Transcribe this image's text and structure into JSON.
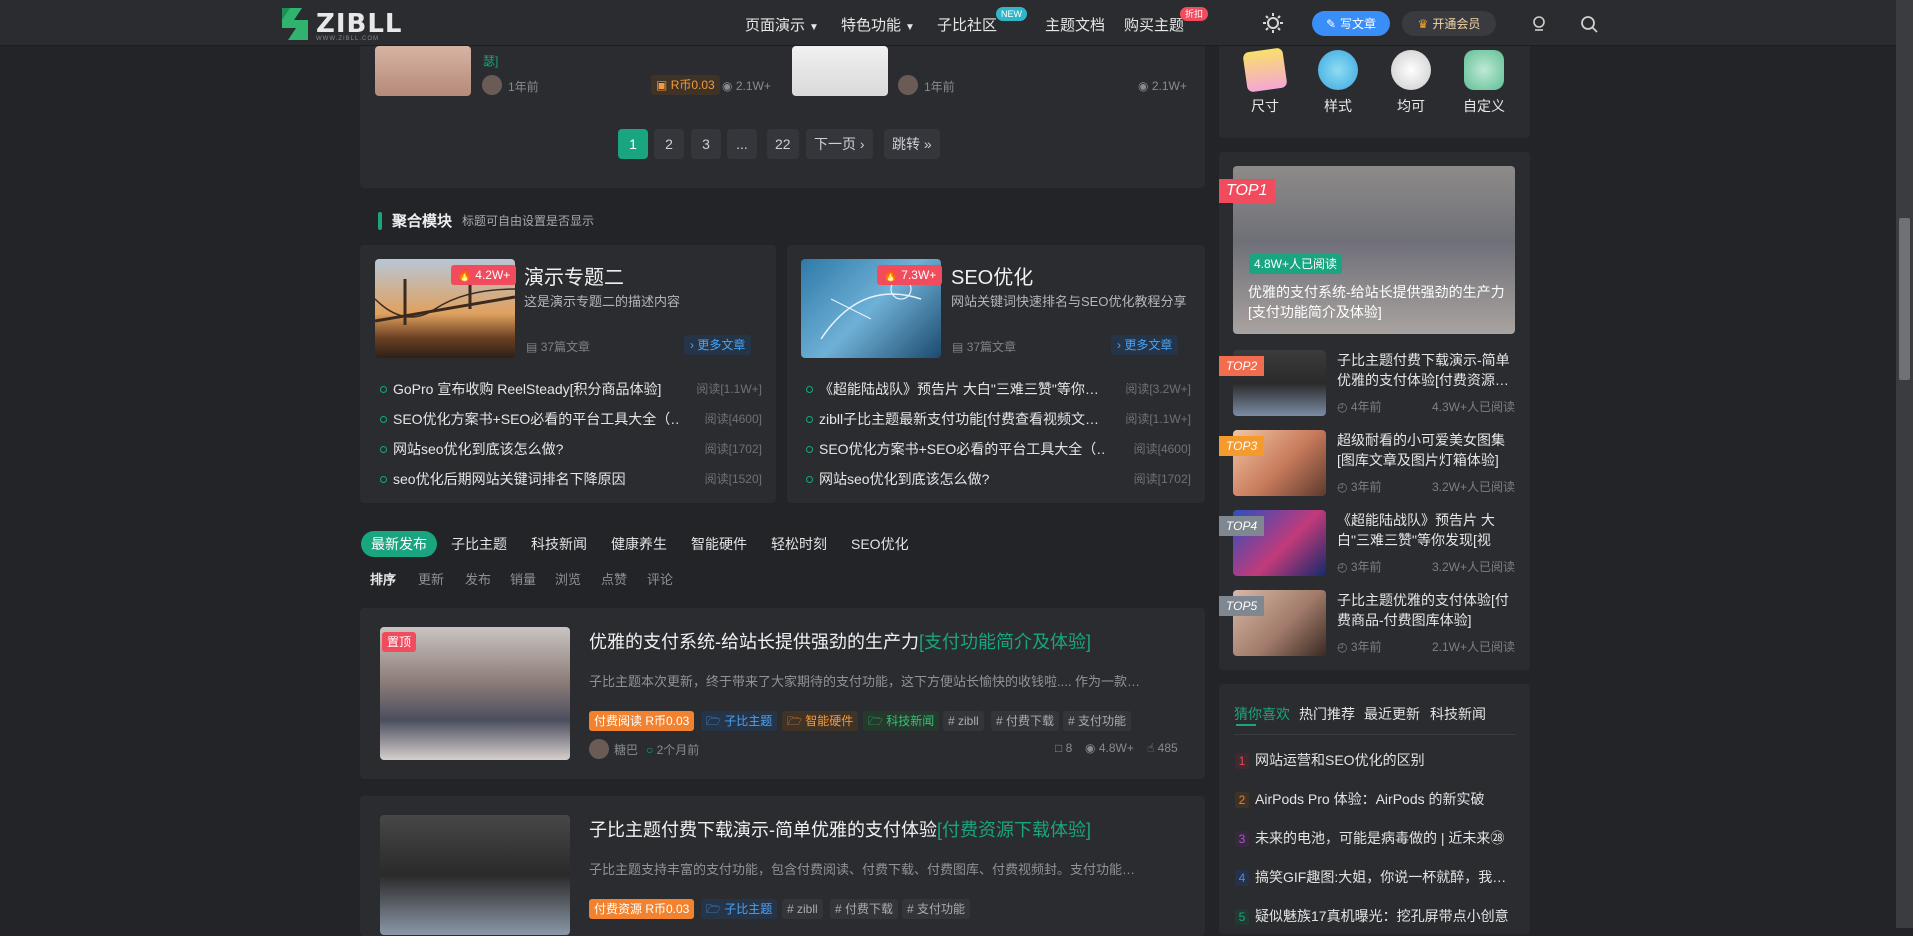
{
  "header": {
    "logo_text": "ZIBLL",
    "logo_sub": "WWW.ZIBLL.COM",
    "nav": [
      {
        "label": "页面演示",
        "dropdown": true
      },
      {
        "label": "特色功能",
        "dropdown": true
      },
      {
        "label": "子比社区",
        "badge": "NEW"
      },
      {
        "label": "主题文档"
      },
      {
        "label": "购买主题",
        "badge": "折扣"
      }
    ],
    "write_label": "写文章",
    "vip_label": "开通会员"
  },
  "top_posts": [
    {
      "link_fragment": "瑟]",
      "time": "1年前",
      "price": "R币0.03",
      "views": "2.1W+"
    },
    {
      "time": "1年前",
      "views": "2.1W+"
    }
  ],
  "pagination": {
    "pages": [
      "1",
      "2",
      "3",
      "...",
      "22"
    ],
    "current": "1",
    "next": "下一页",
    "jump": "跳转"
  },
  "aggregate": {
    "title": "聚合模块",
    "desc": "标题可自由设置是否显示",
    "topics": [
      {
        "hot": "4.2W+",
        "title": "演示专题二",
        "desc": "这是演示专题二的描述内容",
        "count": "37篇文章",
        "more": "更多文章",
        "links": [
          {
            "text": "GoPro 宣布收购 ReelSteady[积分商品体验]",
            "reads": "阅读[1.1W+]"
          },
          {
            "text": "SEO优化方案书+SEO必看的平台工具大全（…",
            "reads": "阅读[4600]"
          },
          {
            "text": "网站seo优化到底该怎么做?",
            "reads": "阅读[1702]"
          },
          {
            "text": "seo优化后期网站关键词排名下降原因",
            "reads": "阅读[1520]"
          }
        ]
      },
      {
        "hot": "7.3W+",
        "title": "SEO优化",
        "desc": "网站关键词快速排名与SEO优化教程分享",
        "count": "37篇文章",
        "more": "更多文章",
        "links": [
          {
            "text": "《超能陆战队》预告片 大白\"三难三赞\"等你…",
            "reads": "阅读[3.2W+]"
          },
          {
            "text": "zibll子比主题最新支付功能[付费查看视频文…",
            "reads": "阅读[1.1W+]"
          },
          {
            "text": "SEO优化方案书+SEO必看的平台工具大全（…",
            "reads": "阅读[4600]"
          },
          {
            "text": "网站seo优化到底该怎么做?",
            "reads": "阅读[1702]"
          }
        ]
      }
    ]
  },
  "tabs": [
    "最新发布",
    "子比主题",
    "科技新闻",
    "健康养生",
    "智能硬件",
    "轻松时刻",
    "SEO优化"
  ],
  "sort": {
    "label": "排序",
    "options": [
      "更新",
      "发布",
      "销量",
      "浏览",
      "点赞",
      "评论"
    ]
  },
  "posts": [
    {
      "sticky": "置顶",
      "title": "优雅的支付系统-给站长提供强劲的生产力",
      "title_hl": "[支付功能简介及体验]",
      "excerpt": "子比主题本次更新，终于带来了大家期待的支付功能，这下方便站长愉快的收钱啦.... 作为一款…",
      "tags": [
        "付费阅读 R币0.03",
        "子比主题",
        "智能硬件",
        "科技新闻",
        "# zibll",
        "# 付费下载",
        "# 支付功能"
      ],
      "author": "糖巴",
      "time": "2个月前",
      "comments": "8",
      "views": "4.8W+",
      "likes": "485"
    },
    {
      "title": "子比主题付费下载演示-简单优雅的支付体验",
      "title_hl": "[付费资源下载体验]",
      "excerpt": "子比主题支持丰富的支付功能，包含付费阅读、付费下载、付费图库、付费视频封。支付功能…",
      "tags": [
        "付费资源 R币0.03",
        "子比主题",
        "# zibll",
        "# 付费下载",
        "# 支付功能"
      ]
    }
  ],
  "sidebar": {
    "categories": [
      "尺寸",
      "样式",
      "均可",
      "自定义"
    ],
    "top1": {
      "badge": "TOP1",
      "reads": "4.8W+人已阅读",
      "title": "优雅的支付系统-给站长提供强劲的生产力[支付功能简介及体验]"
    },
    "tops": [
      {
        "badge": "TOP2",
        "title": "子比主题付费下载演示-简单优雅的支付体验[付费资源…",
        "time": "4年前",
        "reads": "4.3W+人已阅读"
      },
      {
        "badge": "TOP3",
        "title": "超级耐看的小可爱美女图集[图库文章及图片灯箱体验]",
        "time": "3年前",
        "reads": "3.2W+人已阅读"
      },
      {
        "badge": "TOP4",
        "title": "《超能陆战队》预告片 大白\"三难三赞\"等你发现[视频…",
        "time": "3年前",
        "reads": "3.2W+人已阅读"
      },
      {
        "badge": "TOP5",
        "title": "子比主题优雅的支付体验[付费商品-付费图库体验]",
        "time": "3年前",
        "reads": "2.1W+人已阅读"
      }
    ],
    "rank_tabs": [
      "猜你喜欢",
      "热门推荐",
      "最近更新",
      "科技新闻"
    ],
    "rank": [
      {
        "num": "1",
        "text": "网站运营和SEO优化的区别",
        "color": "#e8455a"
      },
      {
        "num": "2",
        "text": "AirPods Pro 体验：AirPods 的新实破",
        "color": "#f07d2e"
      },
      {
        "num": "3",
        "text": "未来的电池，可能是病毒做的 | 近未来㉘",
        "color": "#b84fd1"
      },
      {
        "num": "4",
        "text": "搞笑GIF趣图:大姐，你说一杯就醉，我…",
        "color": "#3b8ff0"
      },
      {
        "num": "5",
        "text": "疑似魅族17真机曝光：挖孔屏带点小创意",
        "color": "#18a57f"
      }
    ]
  },
  "colors": {
    "accent": "#18a57f",
    "hot": "#f14c5e",
    "blue": "#3a8ef7"
  }
}
